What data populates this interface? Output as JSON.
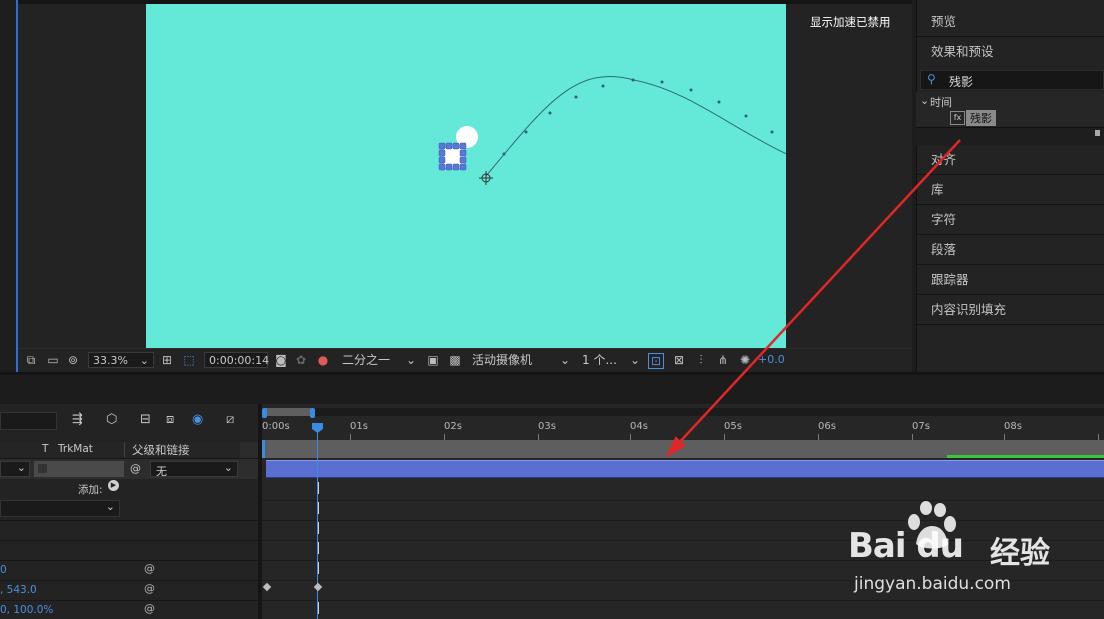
{
  "viewer": {
    "accel_notice": "显示加速已禁用",
    "zoom": "33.3%",
    "timecode": "0:00:00:14",
    "resolution": "二分之一",
    "camera": "活动摄像机",
    "views": "1 个...",
    "exposure": "+0.0",
    "canvas_color": "#64e8d8"
  },
  "right_panel": {
    "items": [
      "预览",
      "效果和预设",
      "对齐",
      "库",
      "字符",
      "段落",
      "跟踪器",
      "内容识别填充"
    ],
    "search_value": "残影",
    "tree_folder": "时间",
    "tree_effect": "残影"
  },
  "timeline": {
    "ruler": [
      "0:00s",
      "01s",
      "02s",
      "03s",
      "04s",
      "05s",
      "06s",
      "07s",
      "08s"
    ],
    "columns": {
      "t": "T",
      "trkmat": "TrkMat",
      "parent": "父级和链接"
    },
    "parent_value": "无",
    "add_label": "添加:",
    "values": [
      "0",
      ", 543.0",
      "0, 100.0%"
    ],
    "layer_bar_color": "#5a6fd0",
    "playhead_color": "#3a8be6"
  },
  "watermark": {
    "brand": "Bai",
    "brand2": "du",
    "cn": "经验",
    "url": "jingyan.baidu.com"
  }
}
